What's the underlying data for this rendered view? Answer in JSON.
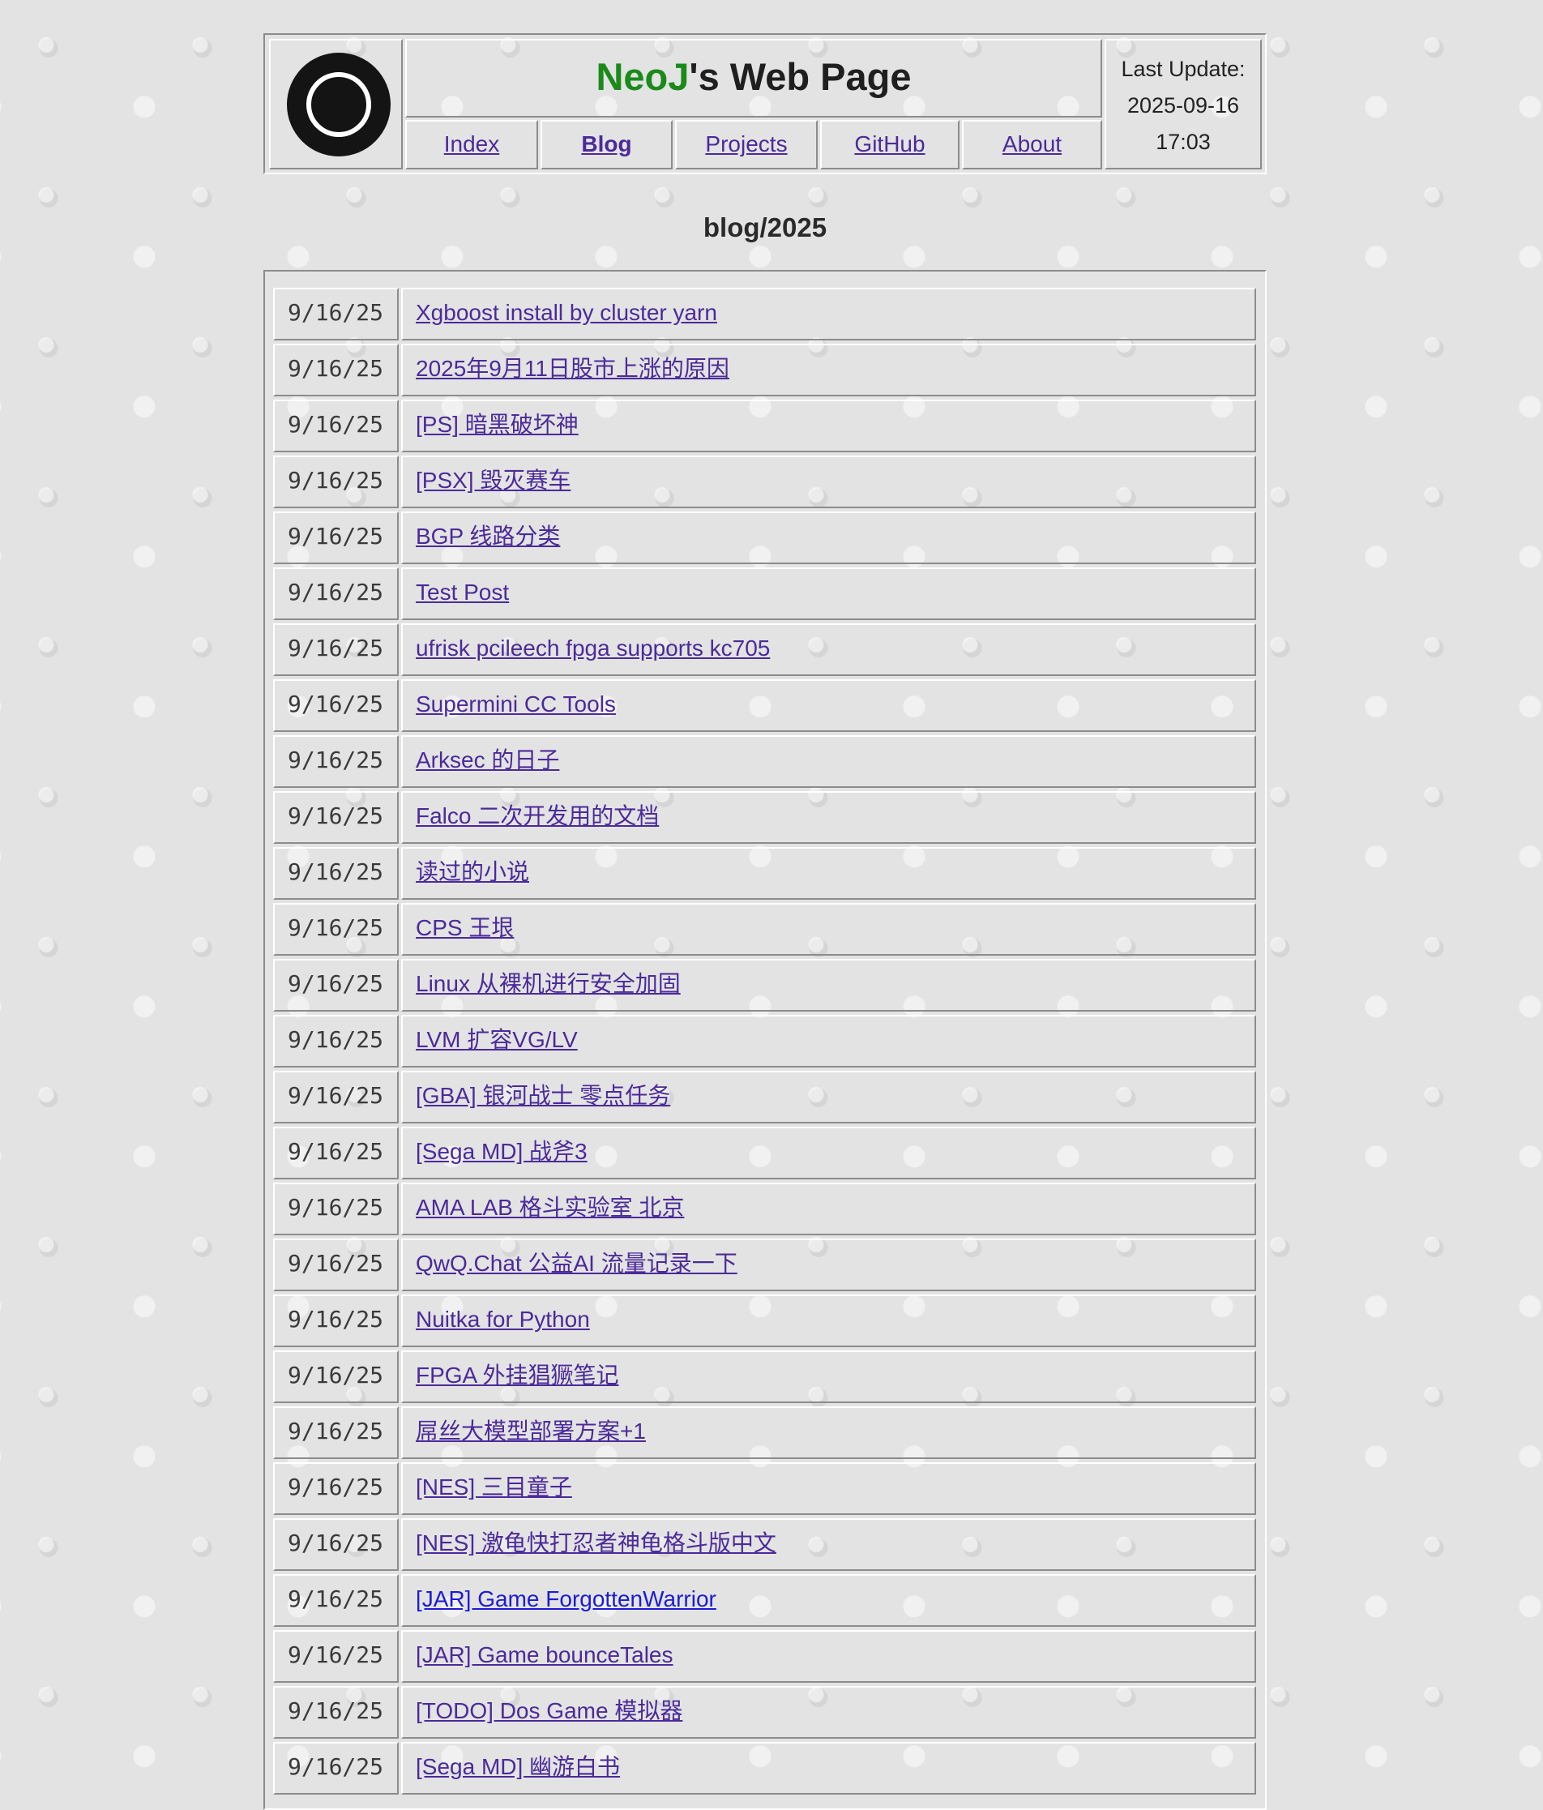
{
  "header": {
    "title_brand": "NeoJ",
    "title_rest": "'s Web Page",
    "last_update_label": "Last Update:",
    "last_update_date": "2025-09-16",
    "last_update_time": "17:03"
  },
  "nav": [
    {
      "label": "Index",
      "active": false
    },
    {
      "label": "Blog",
      "active": true
    },
    {
      "label": "Projects",
      "active": false
    },
    {
      "label": "GitHub",
      "active": false
    },
    {
      "label": "About",
      "active": false
    }
  ],
  "page_heading": "blog/2025",
  "posts": [
    {
      "date": "9/16/25",
      "title": "Xgboost install by cluster yarn"
    },
    {
      "date": "9/16/25",
      "title": "2025年9月11日股市上涨的原因"
    },
    {
      "date": "9/16/25",
      "title": "[PS] 暗黑破坏神"
    },
    {
      "date": "9/16/25",
      "title": "[PSX] 毁灭赛车"
    },
    {
      "date": "9/16/25",
      "title": "BGP 线路分类"
    },
    {
      "date": "9/16/25",
      "title": "Test Post"
    },
    {
      "date": "9/16/25",
      "title": "ufrisk pcileech fpga supports kc705"
    },
    {
      "date": "9/16/25",
      "title": "Supermini CC Tools"
    },
    {
      "date": "9/16/25",
      "title": "Arksec 的日子"
    },
    {
      "date": "9/16/25",
      "title": "Falco 二次开发用的文档"
    },
    {
      "date": "9/16/25",
      "title": "读过的小说"
    },
    {
      "date": "9/16/25",
      "title": "CPS 王垠"
    },
    {
      "date": "9/16/25",
      "title": "Linux 从裸机进行安全加固"
    },
    {
      "date": "9/16/25",
      "title": "LVM 扩容VG/LV"
    },
    {
      "date": "9/16/25",
      "title": "[GBA] 银河战士 零点任务"
    },
    {
      "date": "9/16/25",
      "title": "[Sega MD] 战斧3"
    },
    {
      "date": "9/16/25",
      "title": "AMA LAB 格斗实验室 北京"
    },
    {
      "date": "9/16/25",
      "title": "QwQ.Chat 公益AI 流量记录一下"
    },
    {
      "date": "9/16/25",
      "title": "Nuitka for Python"
    },
    {
      "date": "9/16/25",
      "title": "FPGA 外挂猖獗笔记"
    },
    {
      "date": "9/16/25",
      "title": "屌丝大模型部署方案+1"
    },
    {
      "date": "9/16/25",
      "title": "[NES] 三目童子"
    },
    {
      "date": "9/16/25",
      "title": "[NES] 激龟快打忍者神龟格斗版中文"
    },
    {
      "date": "9/16/25",
      "title": "[JAR] Game ForgottenWarrior",
      "unvisited": true
    },
    {
      "date": "9/16/25",
      "title": "[JAR] Game bounceTales"
    },
    {
      "date": "9/16/25",
      "title": "[TODO] Dos Game 模拟器"
    },
    {
      "date": "9/16/25",
      "title": "[Sega MD] 幽游白书"
    }
  ]
}
